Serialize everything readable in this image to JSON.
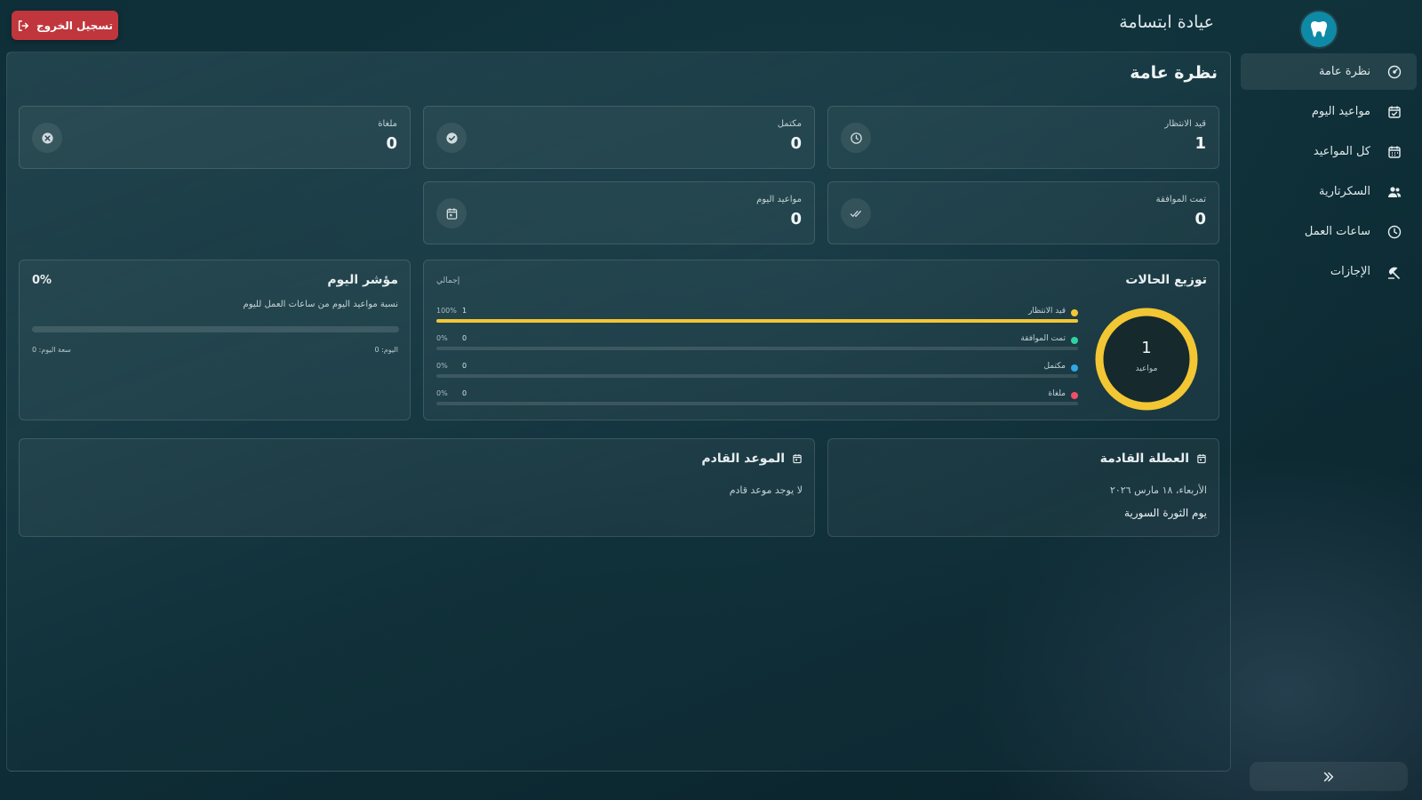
{
  "header": {
    "app_title": "عيادة ابتسامة",
    "logout_label": "تسجيل الخروج"
  },
  "sidebar": {
    "items": [
      {
        "label": "نظرة عامة",
        "icon": "dashboard-gauge-icon",
        "active": true
      },
      {
        "label": "مواعيد اليوم",
        "icon": "calendar-check-icon"
      },
      {
        "label": "كل المواعيد",
        "icon": "calendar-icon"
      },
      {
        "label": "السكرتارية",
        "icon": "users-icon"
      },
      {
        "label": "ساعات العمل",
        "icon": "clock-icon"
      },
      {
        "label": "الإجازات",
        "icon": "beach-umbrella-icon"
      }
    ],
    "collapse_icon": "double-chevron-icon"
  },
  "main": {
    "title": "نظرة عامة",
    "stats": {
      "pending": {
        "label": "قيد الانتظار",
        "value": "1",
        "icon": "clock-icon"
      },
      "completed": {
        "label": "مكتمل",
        "value": "0",
        "icon": "check-circle-icon"
      },
      "cancelled": {
        "label": "ملغاة",
        "value": "0",
        "icon": "x-circle-icon"
      },
      "approved": {
        "label": "تمت الموافقة",
        "value": "0",
        "icon": "double-check-icon"
      },
      "today": {
        "label": "مواعيد اليوم",
        "value": "0",
        "icon": "calendar-icon"
      }
    },
    "distribution": {
      "title": "توزيع الحالات",
      "total_label": "إجمالي",
      "donut_value": "1",
      "donut_label": "مواعيد",
      "rows": [
        {
          "label": "قيد الانتظار",
          "percent": "100%",
          "count": "1",
          "fraction": 1.0,
          "color": "#f2c733"
        },
        {
          "label": "تمت الموافقة",
          "percent": "0%",
          "count": "0",
          "fraction": 0,
          "color": "#2fd3a0"
        },
        {
          "label": "مكتمل",
          "percent": "0%",
          "count": "0",
          "fraction": 0,
          "color": "#2ea8e6"
        },
        {
          "label": "ملغاة",
          "percent": "0%",
          "count": "0",
          "fraction": 0,
          "color": "#ef4f67"
        }
      ]
    },
    "indicator": {
      "title": "مؤشر اليوم",
      "percent": "0%",
      "fraction": 0,
      "description": "نسبة مواعيد اليوم من ساعات العمل لليوم",
      "left_text": "سعة اليوم: 0",
      "right_text": "اليوم: 0"
    },
    "next_holiday": {
      "title": "العطلة القادمة",
      "date": "الأربعاء، ١٨ مارس ٢٠٢٦",
      "name": "يوم الثورة السورية"
    },
    "next_appointment": {
      "title": "الموعد القادم",
      "empty_text": "لا يوجد موعد قادم"
    }
  }
}
